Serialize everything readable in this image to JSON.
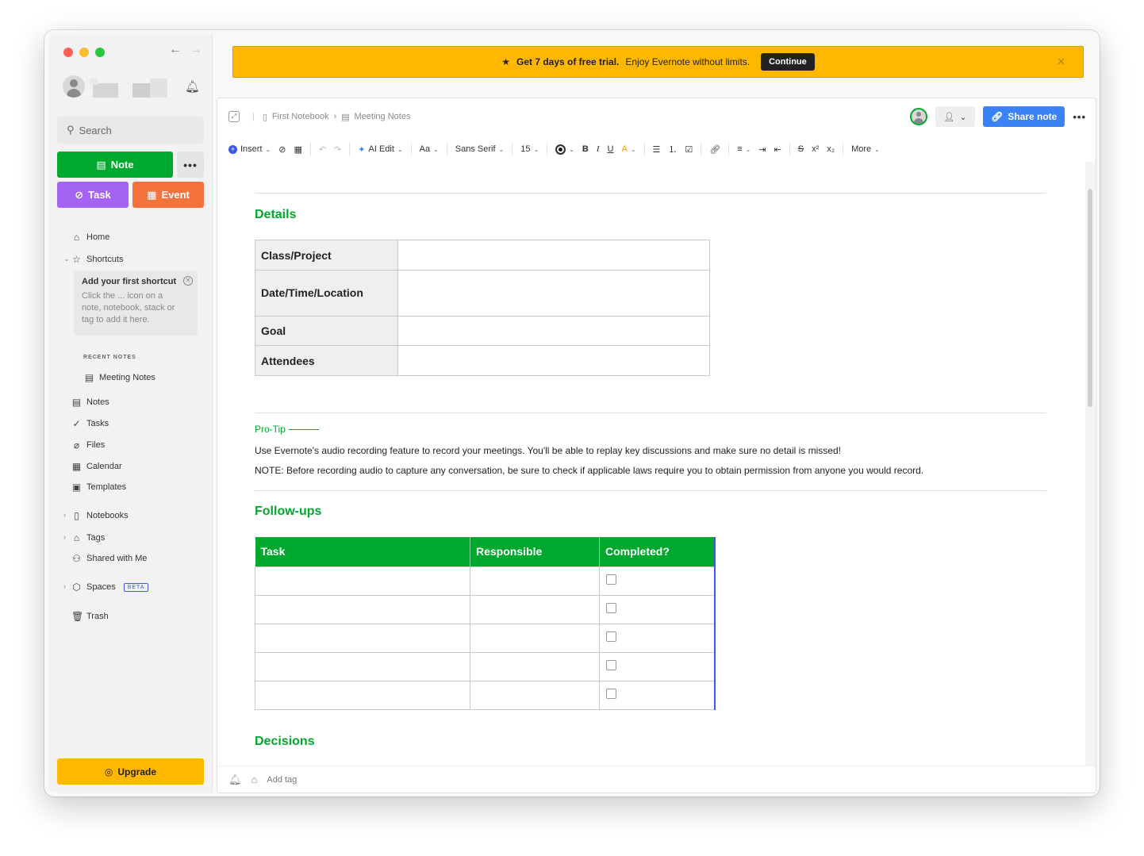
{
  "sidebar": {
    "search_placeholder": "Search",
    "new_note": "Note",
    "new_task": "Task",
    "new_event": "Event",
    "more": "•••",
    "nav": {
      "home": "Home",
      "shortcuts": "Shortcuts",
      "notes": "Notes",
      "tasks": "Tasks",
      "files": "Files",
      "calendar": "Calendar",
      "templates": "Templates",
      "notebooks": "Notebooks",
      "tags": "Tags",
      "shared": "Shared with Me",
      "spaces": "Spaces",
      "spaces_badge": "BETA",
      "trash": "Trash"
    },
    "shortcut_box": {
      "title": "Add your first shortcut",
      "body": "Click the ... icon on a note, notebook, stack or tag to add it here."
    },
    "recent_label": "RECENT NOTES",
    "recent_notes": [
      "Meeting Notes"
    ],
    "upgrade": "Upgrade"
  },
  "banner": {
    "strong": "Get 7 days of free trial.",
    "text": "Enjoy Evernote without limits.",
    "cta": "Continue",
    "close": "✕"
  },
  "editor": {
    "breadcrumb": {
      "notebook": "First Notebook",
      "note": "Meeting Notes",
      "sep": "›"
    },
    "share": "Share note",
    "more": "•••",
    "toolbar": {
      "insert": "Insert",
      "ai_edit": "AI Edit",
      "text_style": "Aa",
      "font": "Sans Serif",
      "size": "15",
      "bold": "B",
      "italic": "I",
      "underline": "U",
      "superscript": "x²",
      "subscript": "x₂",
      "more": "More"
    },
    "details_title": "Details",
    "details_rows": [
      {
        "label": "Class/Project",
        "value": ""
      },
      {
        "label": "Date/Time/Location",
        "value": ""
      },
      {
        "label": "Goal",
        "value": ""
      },
      {
        "label": "Attendees",
        "value": ""
      }
    ],
    "protip_label": "Pro-Tip",
    "protip_text": "Use Evernote's audio recording feature to record your meetings. You'll be able to replay key discussions and make sure no detail is missed!",
    "note_text": "NOTE: Before recording audio to capture any conversation, be sure to check if applicable laws require you to obtain permission from anyone you would record.",
    "followups_title": "Follow-ups",
    "followups_headers": [
      "Task",
      "Responsible",
      "Completed?"
    ],
    "followups_row_count": 5,
    "decisions_title": "Decisions",
    "add_tag": "Add tag"
  }
}
